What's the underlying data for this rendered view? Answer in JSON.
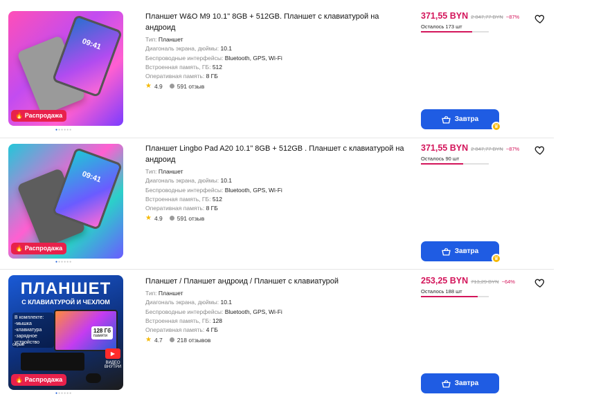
{
  "products": [
    {
      "title": "Планшет W&O M9 10.1\" 8GB + 512GB. Планшет с клавиатурой на андроид",
      "image_text": "09:41",
      "sale_badge": "Распродажа",
      "specs": [
        {
          "key": "Тип:",
          "value": "Планшет"
        },
        {
          "key": "Диагональ экрана, дюймы:",
          "value": "10.1"
        },
        {
          "key": "Беспроводные интерфейсы:",
          "value": "Bluetooth, GPS, Wi-Fi"
        },
        {
          "key": "Встроенная память, ГБ:",
          "value": "512"
        },
        {
          "key": "Оперативная память:",
          "value": "8 ГБ"
        }
      ],
      "rating": "4.9",
      "reviews": "591 отзыв",
      "price": "371,55 BYN",
      "old_price": "2 847,77 BYN",
      "discount": "−87%",
      "stock": "Осталось 173 шт",
      "stock_fill": 0.76,
      "buy_label": "Завтра"
    },
    {
      "title": "Планшет Lingbo Pad A20 10.1\" 8GB + 512GB . Планшет с клавиатурой на андроид",
      "image_text": "09:41",
      "sale_badge": "Распродажа",
      "specs": [
        {
          "key": "Тип:",
          "value": "Планшет"
        },
        {
          "key": "Диагональ экрана, дюймы:",
          "value": "10.1"
        },
        {
          "key": "Беспроводные интерфейсы:",
          "value": "Bluetooth, GPS, Wi-Fi"
        },
        {
          "key": "Встроенная память, ГБ:",
          "value": "512"
        },
        {
          "key": "Оперативная память:",
          "value": "8 ГБ"
        }
      ],
      "rating": "4.9",
      "reviews": "591 отзыв",
      "price": "371,55 BYN",
      "old_price": "2 847,77 BYN",
      "discount": "−87%",
      "stock": "Осталось 90 шт",
      "stock_fill": 0.62,
      "buy_label": "Завтра"
    },
    {
      "title": "Планшет / Планшет андроид / Планшет с клавиатурой",
      "image_title": "ПЛАНШЕТ",
      "image_subtitle": "С КЛАВИАТУРОЙ И ЧЕХЛОМ",
      "image_list": [
        "В комплекте:",
        "-мышка",
        "-клавиатура",
        "-зарядное",
        "устройство"
      ],
      "image_memory": "128 Гб",
      "image_memory_sub": "памяти",
      "image_color": "серый",
      "image_video": "ВИДЕО ВНУТРИ",
      "sale_badge": "Распродажа",
      "specs": [
        {
          "key": "Тип:",
          "value": "Планшет"
        },
        {
          "key": "Диагональ экрана, дюймы:",
          "value": "10.1"
        },
        {
          "key": "Беспроводные интерфейсы:",
          "value": "Bluetooth, GPS, Wi-Fi"
        },
        {
          "key": "Встроенная память, ГБ:",
          "value": "128"
        },
        {
          "key": "Оперативная память:",
          "value": "4 ГБ"
        }
      ],
      "rating": "4.7",
      "reviews": "218 отзывов",
      "price": "253,25 BYN",
      "old_price": "713,29 BYN",
      "discount": "−64%",
      "stock": "Осталось 188 шт",
      "stock_fill": 0.84,
      "buy_label": "Завтра"
    }
  ],
  "icons": {
    "favorite": "heart-outline-icon",
    "cart": "basket-icon",
    "rating": "star-icon",
    "reviews": "chat-bubble-icon",
    "sale": "fire-icon",
    "club": "crown-icon"
  },
  "colors": {
    "price": "#d3145a",
    "button": "#1f5ce3",
    "sale_badge": "#e8214b",
    "star": "#f5b800"
  }
}
